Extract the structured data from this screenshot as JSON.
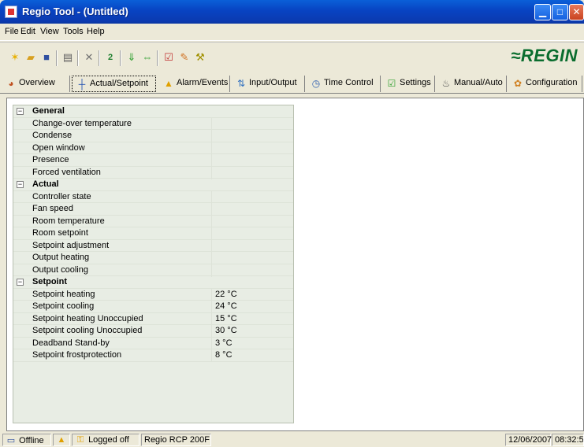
{
  "window": {
    "title": "Regio Tool - (Untitled)"
  },
  "menu": [
    "File",
    "Edit",
    "View",
    "Tools",
    "Help"
  ],
  "logo": "≈REGIN",
  "tabs": [
    {
      "label": "Overview",
      "icon": "overview-icon"
    },
    {
      "label": "Actual/Setpoint",
      "icon": "actual-setpoint-icon",
      "active": true
    },
    {
      "label": "Alarm/Events",
      "icon": "alarm-icon"
    },
    {
      "label": "Input/Output",
      "icon": "input-output-icon"
    },
    {
      "label": "Time Control",
      "icon": "time-control-icon"
    },
    {
      "label": "Settings",
      "icon": "settings-icon"
    },
    {
      "label": "Manual/Auto",
      "icon": "manual-auto-icon"
    },
    {
      "label": "Configuration",
      "icon": "configuration-icon"
    }
  ],
  "groups": [
    {
      "title": "General",
      "rows": [
        {
          "name": "Change-over temperature",
          "value": ""
        },
        {
          "name": "Condense",
          "value": ""
        },
        {
          "name": "Open window",
          "value": ""
        },
        {
          "name": "Presence",
          "value": ""
        },
        {
          "name": "Forced ventilation",
          "value": ""
        }
      ]
    },
    {
      "title": "Actual",
      "rows": [
        {
          "name": "Controller state",
          "value": ""
        },
        {
          "name": "Fan speed",
          "value": ""
        },
        {
          "name": "Room temperature",
          "value": ""
        },
        {
          "name": "Room setpoint",
          "value": ""
        },
        {
          "name": "Setpoint adjustment",
          "value": ""
        },
        {
          "name": "Output heating",
          "value": ""
        },
        {
          "name": "Output cooling",
          "value": ""
        }
      ]
    },
    {
      "title": "Setpoint",
      "rows": [
        {
          "name": "Setpoint heating",
          "value": "22 °C"
        },
        {
          "name": "Setpoint cooling",
          "value": "24 °C"
        },
        {
          "name": "Setpoint heating Unoccupied",
          "value": "15 °C"
        },
        {
          "name": "Setpoint cooling Unoccupied",
          "value": "30 °C"
        },
        {
          "name": "Deadband Stand-by",
          "value": "3 °C"
        },
        {
          "name": "Setpoint frostprotection",
          "value": "8 °C"
        }
      ]
    }
  ],
  "status": {
    "connection": "Offline",
    "login": "Logged off",
    "device": "Regio RCP 200F",
    "date": "12/06/2007",
    "time": "08:32:5"
  }
}
